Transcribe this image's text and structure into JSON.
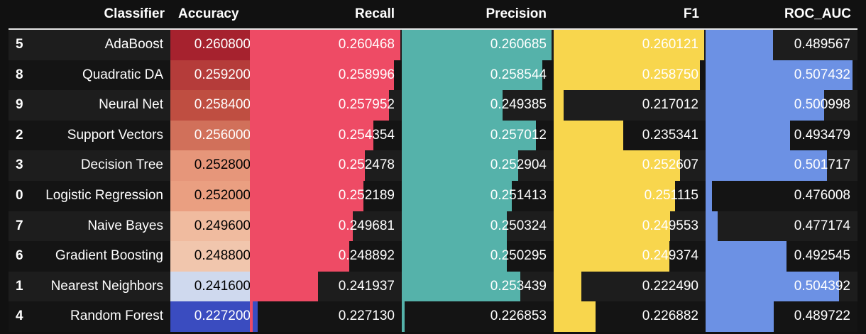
{
  "headers": [
    "Classifier",
    "Accuracy",
    "Recall",
    "Precision",
    "F1",
    "ROC_AUC"
  ],
  "colors": {
    "recall": "#ee4b65",
    "precision": "#55b2aa",
    "f1": "#f8d64d",
    "roc_auc": "#6c91e4"
  },
  "ranges": {
    "recall": [
      0.2265,
      0.2608
    ],
    "precision": [
      0.2262,
      0.2611
    ],
    "f1": [
      0.214,
      0.2605
    ],
    "roc_auc": [
      0.4745,
      0.5085
    ]
  },
  "rows": [
    {
      "index": "5",
      "classifier": "AdaBoost",
      "accuracy": "0.260800",
      "accuracy_color": "#a6222e",
      "accuracy_text": "#ffffff",
      "recall": "0.260468",
      "precision": "0.260685",
      "f1": "0.260121",
      "roc_auc": "0.489567"
    },
    {
      "index": "8",
      "classifier": "Quadratic DA",
      "accuracy": "0.259200",
      "accuracy_color": "#b53c3a",
      "accuracy_text": "#ffffff",
      "recall": "0.258996",
      "precision": "0.258544",
      "f1": "0.258750",
      "roc_auc": "0.507432"
    },
    {
      "index": "9",
      "classifier": "Neural Net",
      "accuracy": "0.258400",
      "accuracy_color": "#bf4e41",
      "accuracy_text": "#ffffff",
      "recall": "0.257952",
      "precision": "0.249385",
      "f1": "0.217012",
      "roc_auc": "0.500998"
    },
    {
      "index": "2",
      "classifier": "Support Vectors",
      "accuracy": "0.256000",
      "accuracy_color": "#d1705a",
      "accuracy_text": "#ffffff",
      "recall": "0.254354",
      "precision": "0.257012",
      "f1": "0.235341",
      "roc_auc": "0.493479"
    },
    {
      "index": "3",
      "classifier": "Decision Tree",
      "accuracy": "0.252800",
      "accuracy_color": "#e6967a",
      "accuracy_text": "#000000",
      "recall": "0.252478",
      "precision": "0.252904",
      "f1": "0.252607",
      "roc_auc": "0.501717"
    },
    {
      "index": "0",
      "classifier": "Logistic Regression",
      "accuracy": "0.252000",
      "accuracy_color": "#ea9f81",
      "accuracy_text": "#000000",
      "recall": "0.252189",
      "precision": "0.251413",
      "f1": "0.251115",
      "roc_auc": "0.476008"
    },
    {
      "index": "7",
      "classifier": "Naive Bayes",
      "accuracy": "0.249600",
      "accuracy_color": "#f0bb9f",
      "accuracy_text": "#000000",
      "recall": "0.249681",
      "precision": "0.250324",
      "f1": "0.249553",
      "roc_auc": "0.477174"
    },
    {
      "index": "6",
      "classifier": "Gradient Boosting",
      "accuracy": "0.248800",
      "accuracy_color": "#f1c6ad",
      "accuracy_text": "#000000",
      "recall": "0.248892",
      "precision": "0.250295",
      "f1": "0.249374",
      "roc_auc": "0.492545"
    },
    {
      "index": "1",
      "classifier": "Nearest Neighbors",
      "accuracy": "0.241600",
      "accuracy_color": "#cfd9ee",
      "accuracy_text": "#000000",
      "recall": "0.241937",
      "precision": "0.253439",
      "f1": "0.222490",
      "roc_auc": "0.504392"
    },
    {
      "index": "4",
      "classifier": "Random Forest",
      "accuracy": "0.227200",
      "accuracy_color": "#3a4cc0",
      "accuracy_text": "#ffffff",
      "recall": "0.227130",
      "precision": "0.226853",
      "f1": "0.226882",
      "roc_auc": "0.489722"
    }
  ]
}
